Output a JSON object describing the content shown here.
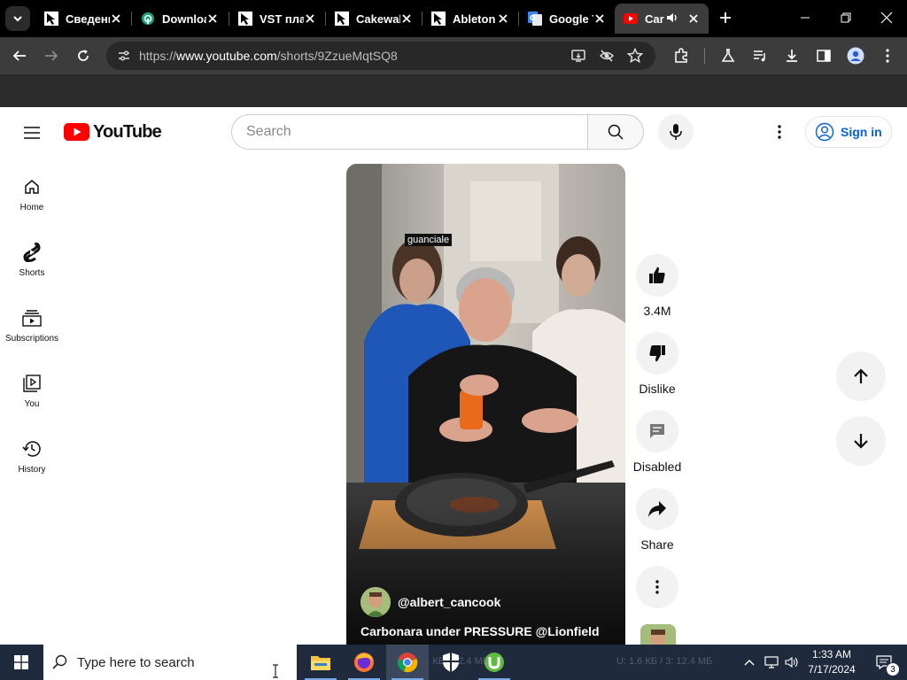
{
  "browser": {
    "tabs": [
      {
        "title": "Сведения",
        "icon": "cursor-arrow-icon"
      },
      {
        "title": "Downloads",
        "icon": "download-site-icon"
      },
      {
        "title": "VST плагины",
        "icon": "cursor-arrow-icon"
      },
      {
        "title": "Cakewalk",
        "icon": "cursor-arrow-icon"
      },
      {
        "title": "Ableton",
        "icon": "cursor-arrow-icon"
      },
      {
        "title": "Google Translate",
        "icon": "google-translate-icon"
      },
      {
        "title": "Carbonara",
        "icon": "youtube-icon",
        "active": true,
        "audio": true
      }
    ],
    "url": {
      "prefix": "https://",
      "host": "www.youtube.com",
      "path": "/shorts/9ZzueMqtSQ8"
    }
  },
  "youtube": {
    "logo_text": "YouTube",
    "search": {
      "placeholder": "Search"
    },
    "signin_label": "Sign in",
    "guide": [
      {
        "label": "Home",
        "icon": "home-icon"
      },
      {
        "label": "Shorts",
        "icon": "shorts-icon"
      },
      {
        "label": "Subscriptions",
        "icon": "subscriptions-icon"
      },
      {
        "label": "You",
        "icon": "you-icon"
      },
      {
        "label": "History",
        "icon": "history-icon"
      }
    ],
    "short": {
      "sticker": "guanciale",
      "channel": "@albert_cancook",
      "title": "Carbonara under PRESSURE @Lionfield"
    },
    "actions": {
      "like_count": "3.4M",
      "dislike_label": "Dislike",
      "comments_label": "Disabled",
      "share_label": "Share"
    }
  },
  "taskbar": {
    "search_placeholder": "Type here to search",
    "ghost_left": "7.1 КБ / 12.4 МБ",
    "ghost_right": "U: 1.6 КБ / 3: 12.4 МБ",
    "time": "1:33 AM",
    "date": "7/17/2024",
    "notification_count": "3"
  },
  "colors": {
    "youtube_red": "#ff0000",
    "link_blue": "#065fd4",
    "taskbar": "#1f2a3c",
    "chrome_dark": "#3c3c3c"
  }
}
